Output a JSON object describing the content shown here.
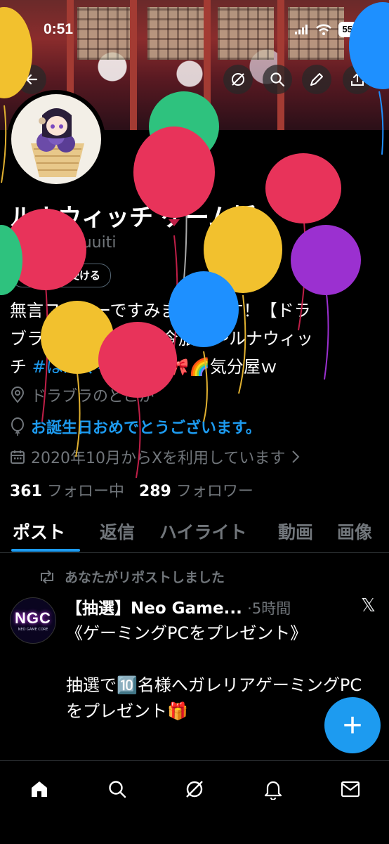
{
  "status_bar": {
    "time": "0:51",
    "battery": "55"
  },
  "profile": {
    "display_name": "ルナウィッチ ゲーム垢",
    "handle": "@sanuuuuuiti",
    "verify_button": "認証を受ける",
    "bio_line1": "無言フォローですみませんです！【ドラ",
    "bio_line2": "ブラ】言葉の花鯖～今旅中～ルナウィッ",
    "bio_line3_pre": "チ ",
    "bio_hashtag": "#はんぐるーす",
    "bio_line3_post": "🤙🎀🌈気分屋ｗ",
    "location": "ドラブラのどこか",
    "birthday": "お誕生日おめでとうございます。",
    "joined": "2020年10月からXを利用しています",
    "following_count": "361",
    "following_label": "フォロー中",
    "followers_count": "289",
    "followers_label": "フォロワー"
  },
  "tabs": [
    "ポスト",
    "返信",
    "ハイライト",
    "動画",
    "画像"
  ],
  "post": {
    "repost_text": "あなたがリポストしました",
    "avatar_text": "NGC",
    "avatar_subtext": "NEO GAME CORE",
    "author": "【抽選】Neo Game...",
    "time": "·5時間",
    "x_logo": "𝕏",
    "body": "《ゲーミングPCをプレゼント》\n\n抽選で🔟名様へガレリアゲーミングPC\nをプレゼント🎁"
  },
  "fab": {
    "label": "+"
  },
  "colors": {
    "accent": "#1d9bf0",
    "background": "#000000",
    "muted": "#71767b",
    "balloons": [
      "#f2c12e",
      "#e8335a",
      "#2ec27e",
      "#1e90ff",
      "#9b30d0"
    ]
  },
  "icons": [
    "back-arrow-icon",
    "grok-icon",
    "search-icon",
    "edit-icon",
    "share-icon",
    "location-icon",
    "balloon-icon",
    "calendar-icon",
    "chevron-right-icon",
    "repost-icon",
    "home-icon",
    "notifications-icon",
    "mail-icon"
  ]
}
